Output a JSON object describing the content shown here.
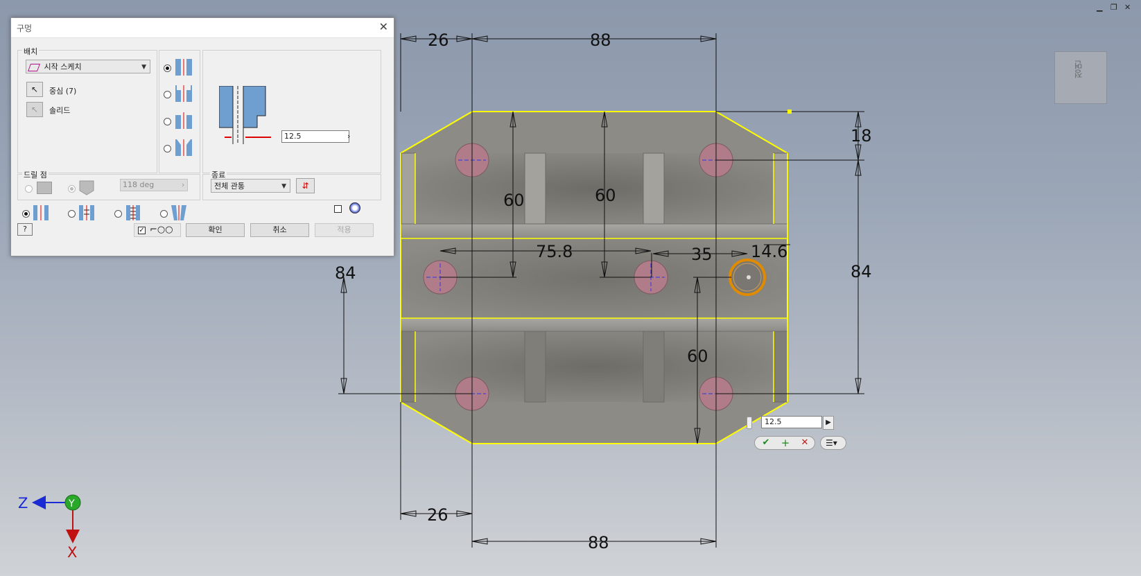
{
  "dialog": {
    "title": "구멍",
    "placement": {
      "label": "배치",
      "source": "시작 스케치",
      "center_label": "중심 (7)",
      "solid_label": "솔리드"
    },
    "diameter": "12.5",
    "drill_point": {
      "label": "드릴 점",
      "angle": "118 deg"
    },
    "termination": {
      "label": "종료",
      "value": "전체 관통"
    },
    "buttons": {
      "ok": "확인",
      "cancel": "취소",
      "apply": "적용"
    }
  },
  "viewcube_label": "정면",
  "dimensions": {
    "top_26": "26",
    "top_88": "88",
    "right_18": "18",
    "right_84": "84",
    "left_84": "84",
    "mid_60_a": "60",
    "mid_60_b": "60",
    "mid_75_8": "75.8",
    "mid_35": "35",
    "mid_14_6": "14.6",
    "low_60": "60",
    "bottom_26": "26",
    "bottom_88": "88"
  },
  "minibar": {
    "value": "12.5"
  },
  "axes": {
    "z": "Z",
    "y": "Y",
    "x": "X"
  },
  "colors": {
    "sketch_edge": "#ffff00",
    "hole_fill": "#b07c89",
    "part_fill": "#8f8d86",
    "active_hole": "#e08a00"
  }
}
